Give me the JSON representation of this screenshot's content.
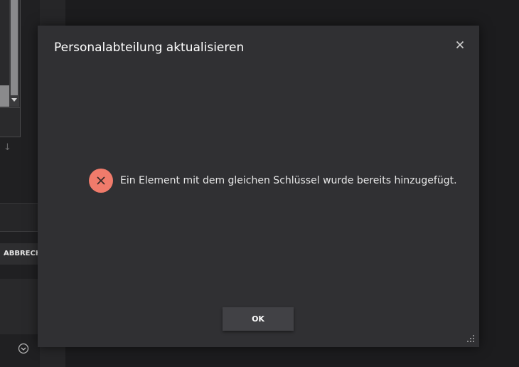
{
  "background": {
    "cancel_button_label": "ABBRECH",
    "icons": [
      "scroll-down-arrow",
      "down-arrow",
      "expand-circle-chevron"
    ]
  },
  "dialog": {
    "title": "Personalabteilung aktualisieren",
    "close_icon": "close-icon",
    "message": {
      "icon": "error-icon",
      "text": "Ein Element mit dem gleichen Schlüssel wurde bereits hinzugefügt."
    },
    "ok_button_label": "OK",
    "resize_icon": "resize-grip-icon"
  },
  "colors": {
    "background": "#1c1c1e",
    "dialog_background": "#303033",
    "error_accent": "#f07b6b",
    "button_background": "#414145",
    "text_primary": "#ffffff"
  }
}
